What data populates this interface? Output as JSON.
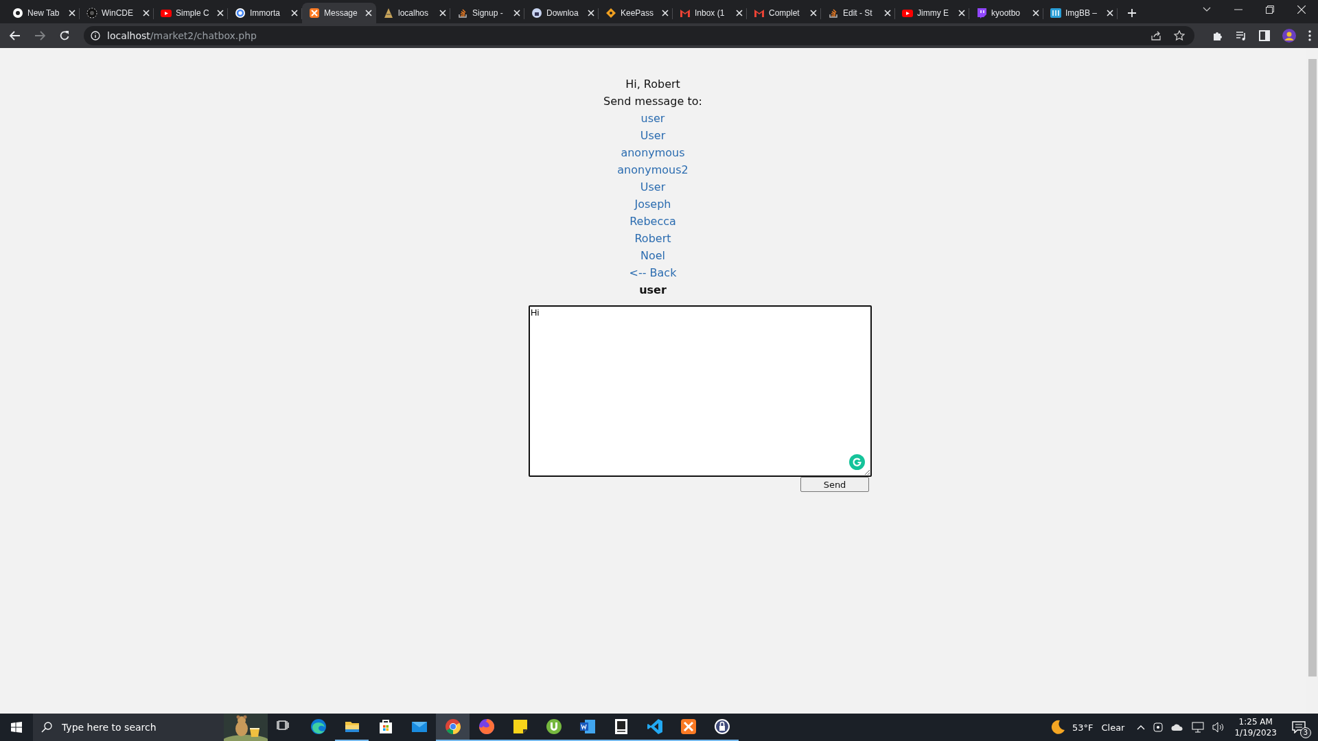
{
  "browser": {
    "tabs": [
      {
        "title": "New Tab",
        "selected": false
      },
      {
        "title": "WinCDE",
        "selected": false
      },
      {
        "title": "Simple C",
        "selected": false
      },
      {
        "title": "Immorta",
        "selected": false
      },
      {
        "title": "Message",
        "selected": true
      },
      {
        "title": "localhos",
        "selected": false
      },
      {
        "title": "Signup -",
        "selected": false
      },
      {
        "title": "Downloa",
        "selected": false
      },
      {
        "title": "KeePass",
        "selected": false
      },
      {
        "title": "Inbox (1",
        "selected": false
      },
      {
        "title": "Complet",
        "selected": false
      },
      {
        "title": "Edit - St",
        "selected": false
      },
      {
        "title": "Jimmy E",
        "selected": false
      },
      {
        "title": "kyootbo",
        "selected": false
      },
      {
        "title": "ImgBB –",
        "selected": false
      }
    ],
    "address": {
      "host": "localhost",
      "path": "/market2/chatbox.php"
    }
  },
  "page": {
    "greeting": "Hi, Robert",
    "prompt": "Send message to:",
    "contacts": [
      "user",
      "User",
      "anonymous",
      "anonymous2",
      "User",
      "Joseph",
      "Rebecca",
      "Robert",
      "Noel"
    ],
    "back_link": "<-- Back",
    "recipient": "user",
    "message": {
      "value": "Hi"
    },
    "send_button": "Send"
  },
  "taskbar": {
    "search": {
      "placeholder": "Type here to search"
    },
    "apps": [
      {
        "running": false,
        "selected": false
      },
      {
        "running": false,
        "selected": false
      },
      {
        "running": true,
        "selected": false
      },
      {
        "running": false,
        "selected": false
      },
      {
        "running": false,
        "selected": false
      },
      {
        "running": true,
        "selected": true
      },
      {
        "running": true,
        "selected": false
      },
      {
        "running": true,
        "selected": false
      },
      {
        "running": true,
        "selected": false
      },
      {
        "running": true,
        "selected": false
      },
      {
        "running": true,
        "selected": false
      },
      {
        "running": true,
        "selected": false
      },
      {
        "running": true,
        "selected": false
      },
      {
        "running": true,
        "selected": false
      }
    ],
    "weather": {
      "temperature": "53°F",
      "condition": "Clear"
    },
    "clock": {
      "time": "1:25 AM",
      "date": "1/19/2023"
    },
    "notifications": "3"
  }
}
